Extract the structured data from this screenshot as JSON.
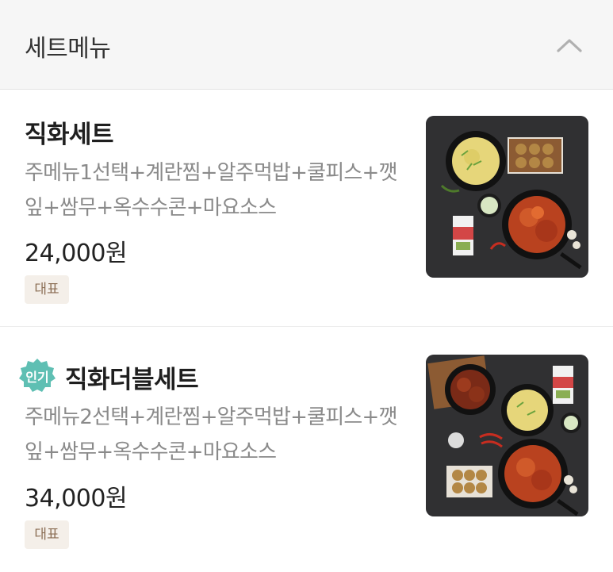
{
  "section": {
    "title": "세트메뉴",
    "toggle_icon": "chevron-up-icon"
  },
  "items": [
    {
      "name": "직화세트",
      "description": "주메뉴1선택+계란찜+알주먹밥+쿨피스+깻잎+쌈무+옥수수콘+마요소스",
      "price": "24,000원",
      "badge": "대표",
      "photo_icon": "food-photo"
    },
    {
      "name": "직화더블세트",
      "popular_label": "인기",
      "description": "주메뉴2선택+계란찜+알주먹밥+쿨피스+깻잎+쌈무+옥수수콘+마요소스",
      "price": "34,000원",
      "badge": "대표",
      "photo_icon": "food-photo"
    }
  ],
  "colors": {
    "header_bg": "#f6f6f6",
    "popular_badge": "#5fbfb3",
    "rep_badge_bg": "#f4efe9",
    "rep_badge_text": "#8b6e55"
  }
}
